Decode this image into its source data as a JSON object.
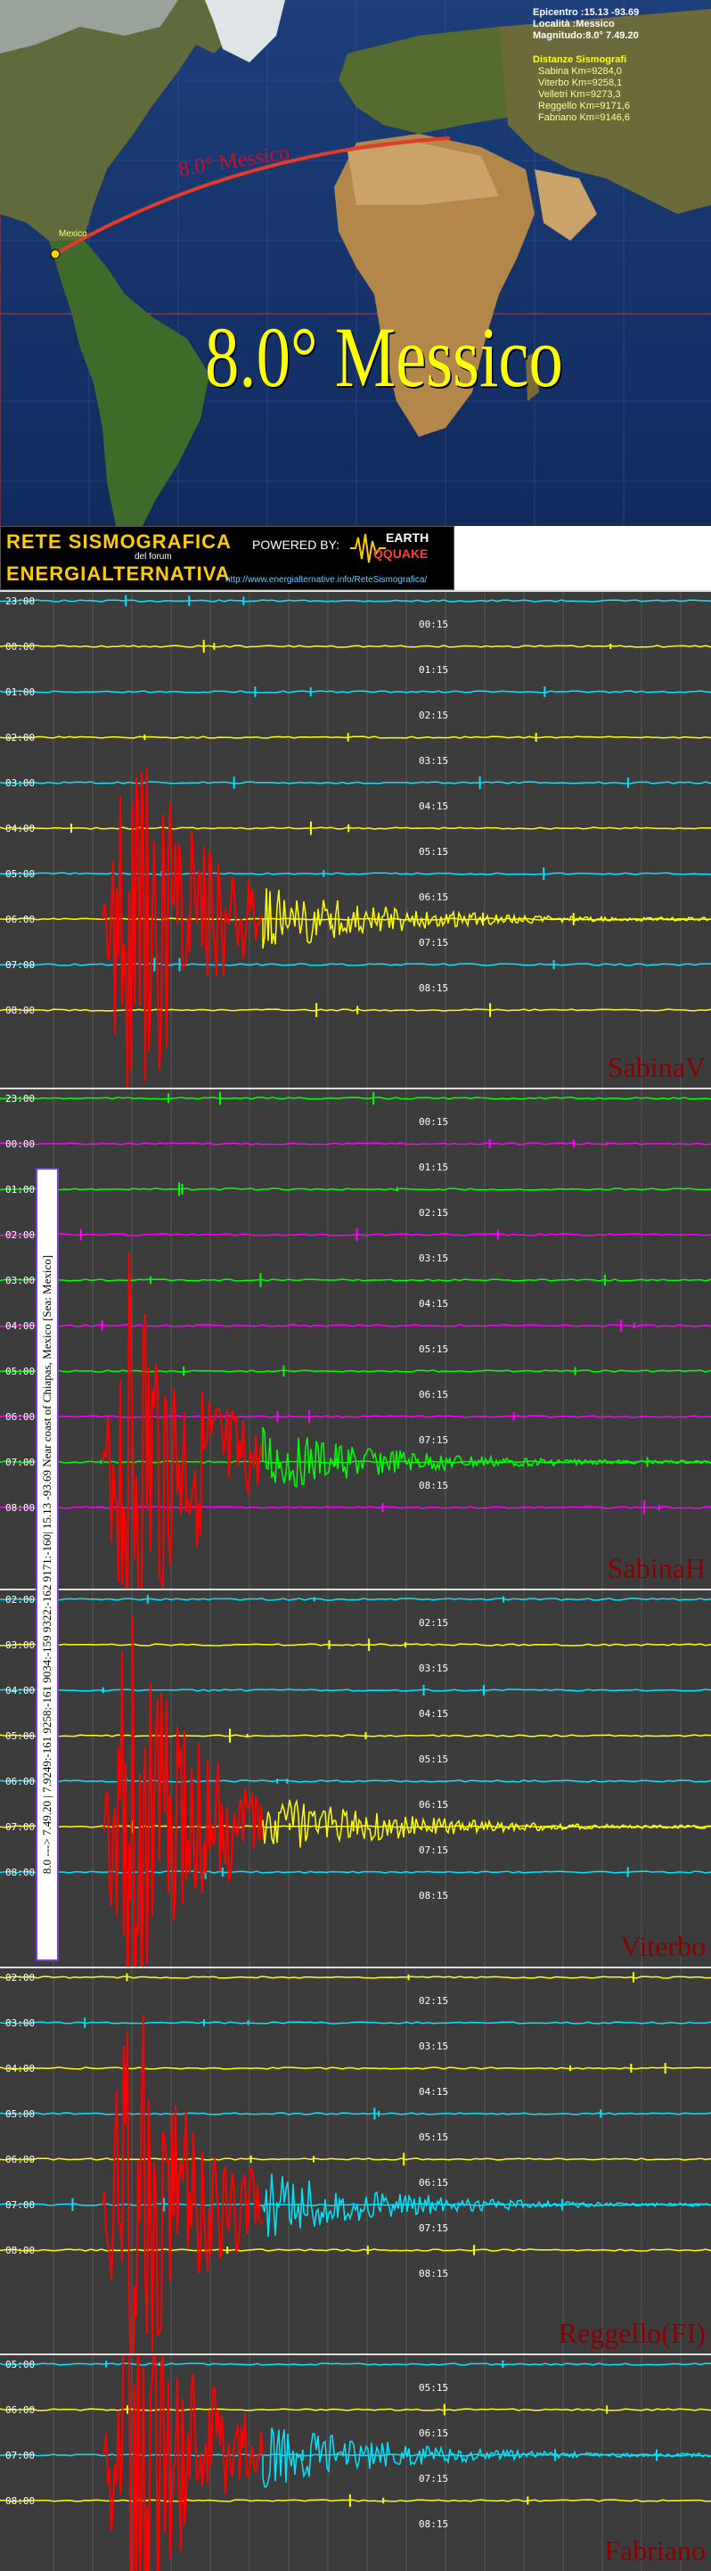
{
  "map": {
    "epicenter_label": "Epicentro :15.13 -93.69",
    "location_label": "Località :Messico",
    "magnitude_label": "Magnitudo:8.0° 7.49.20",
    "distances_title": "Distanze Sismografi",
    "distances": [
      "Sabina Km=9284,0",
      "Viterbo Km=9258,1",
      "Velletri Km=9273,3",
      "Reggello Km=9171,6",
      "Fabriano Km=9146,6"
    ],
    "arc_label": "8.0° Messico",
    "big_title": "8.0° Messico",
    "city_marker": "Mexico"
  },
  "banner": {
    "line1": "RETE SISMOGRAFICA",
    "line2": "del forum",
    "line3": "ENERGIALTERNATIVA",
    "powered": "POWERED BY:",
    "logo1": "EARTH",
    "logo2": "QQUAKE",
    "url": "http://www.energialternative.info/ReteSismografica/"
  },
  "side_caption": "8.0 ---> 7.49.20   |   7.9249:-161 9258:-161 9034:-159 9322:-162 9171:-160|   15.13 -93.69   Near coast of Chiapas, Mexico [Sea: Mexico]",
  "chart_data": [
    {
      "type": "line",
      "station": "SabinaV",
      "time_labels": [
        "23:00",
        "00:00",
        "01:00",
        "02:00",
        "03:00",
        "04:00",
        "05:00",
        "06:00",
        "07:00",
        "08:00"
      ],
      "quarter_labels": [
        "00:15",
        "01:15",
        "02:15",
        "03:15",
        "04:15",
        "05:15",
        "06:15",
        "07:15",
        "08:15"
      ],
      "trace_colors": [
        "#00e5ff",
        "#ffff00"
      ],
      "event_color": "#ff0000",
      "event_trace": 7,
      "line_count": 10
    },
    {
      "type": "line",
      "station": "SabinaH",
      "time_labels": [
        "23:00",
        "00:00",
        "01:00",
        "02:00",
        "03:00",
        "04:00",
        "05:00",
        "06:00",
        "07:00",
        "08:00"
      ],
      "quarter_labels": [
        "00:15",
        "01:15",
        "02:15",
        "03:15",
        "04:15",
        "05:15",
        "06:15",
        "07:15",
        "08:15"
      ],
      "trace_colors": [
        "#00ff00",
        "#ff00ff"
      ],
      "event_color": "#ff0000",
      "event_trace": 8,
      "line_count": 10
    },
    {
      "type": "line",
      "station": "Viterbo",
      "time_labels": [
        "02:00",
        "03:00",
        "04:00",
        "05:00",
        "06:00",
        "07:00",
        "08:00"
      ],
      "quarter_labels": [
        "02:15",
        "03:15",
        "04:15",
        "05:15",
        "06:15",
        "07:15",
        "08:15"
      ],
      "trace_colors": [
        "#00e5ff",
        "#ffff00"
      ],
      "event_color": "#ff0000",
      "event_trace": 5,
      "line_count": 7
    },
    {
      "type": "line",
      "station": "Reggello(FI)",
      "time_labels": [
        "02:00",
        "03:00",
        "04:00",
        "05:00",
        "06:00",
        "07:00",
        "08:00"
      ],
      "quarter_labels": [
        "02:15",
        "03:15",
        "04:15",
        "05:15",
        "06:15",
        "07:15",
        "08:15"
      ],
      "trace_colors": [
        "#ffff00",
        "#00e5ff"
      ],
      "event_color": "#ff0000",
      "event_trace": 5,
      "line_count": 7
    },
    {
      "type": "line",
      "station": "Fabriano",
      "time_labels": [
        "05:00",
        "06:00",
        "07:00",
        "08:00"
      ],
      "quarter_labels": [
        "05:15",
        "06:15",
        "07:15",
        "08:15"
      ],
      "trace_colors": [
        "#00e5ff",
        "#ffff00"
      ],
      "event_color": "#ff0000",
      "event_trace": 2,
      "line_count": 4
    }
  ]
}
